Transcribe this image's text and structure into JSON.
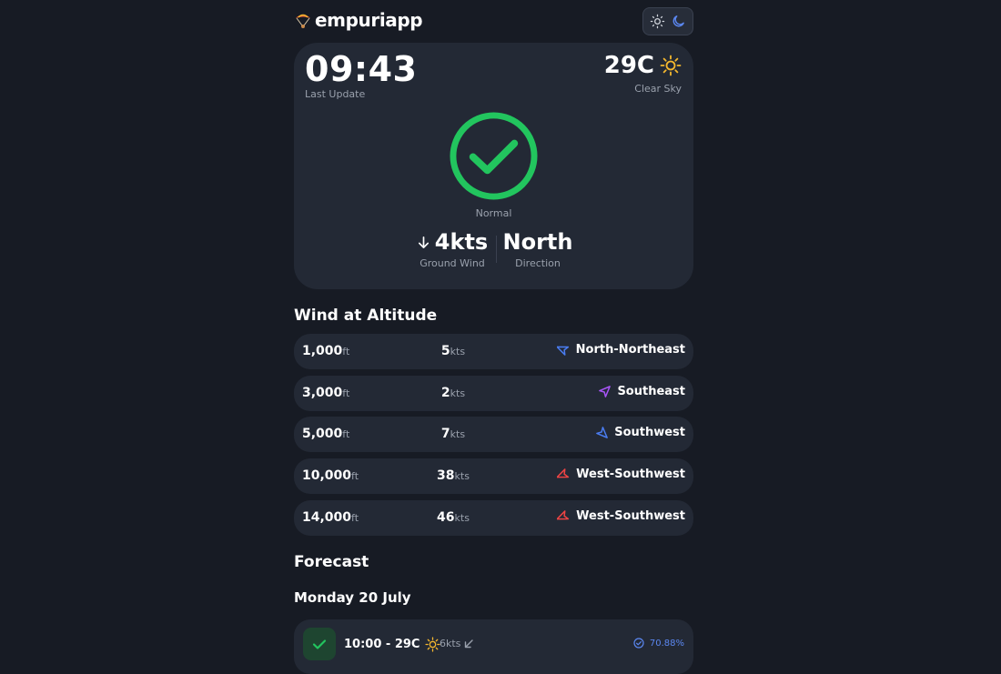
{
  "app": {
    "name": "empuriapp"
  },
  "current": {
    "time": "09:43",
    "time_caption": "Last Update",
    "temperature": "29C",
    "condition": "Clear Sky",
    "status": "Normal",
    "ground_wind": "4kts",
    "ground_wind_caption": "Ground Wind",
    "direction": "North",
    "direction_caption": "Direction"
  },
  "altitude": {
    "title": "Wind at Altitude",
    "rows": [
      {
        "height": "1,000",
        "height_unit": "ft",
        "speed": "5",
        "speed_unit": "kts",
        "direction": "North-Northeast",
        "arrow_color": "#4a7cf0"
      },
      {
        "height": "3,000",
        "height_unit": "ft",
        "speed": "2",
        "speed_unit": "kts",
        "direction": "Southeast",
        "arrow_color": "#a855f7"
      },
      {
        "height": "5,000",
        "height_unit": "ft",
        "speed": "7",
        "speed_unit": "kts",
        "direction": "Southwest",
        "arrow_color": "#4a7cf0"
      },
      {
        "height": "10,000",
        "height_unit": "ft",
        "speed": "38",
        "speed_unit": "kts",
        "direction": "West-Southwest",
        "arrow_color": "#ef4444"
      },
      {
        "height": "14,000",
        "height_unit": "ft",
        "speed": "46",
        "speed_unit": "kts",
        "direction": "West-Southwest",
        "arrow_color": "#ef4444"
      }
    ]
  },
  "forecast": {
    "title": "Forecast",
    "day": "Monday 20 July",
    "items": [
      {
        "time_temp": "10:00 - 29C",
        "wind": "6kts",
        "probability": "70.88%"
      }
    ]
  },
  "colors": {
    "status_green": "#22c55e",
    "sun_yellow": "#f5b82e",
    "accent_blue": "#5b87f0"
  }
}
